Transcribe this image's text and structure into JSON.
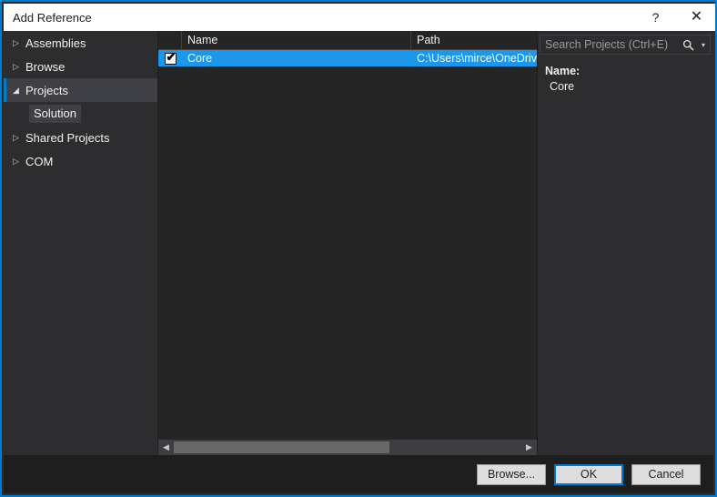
{
  "window": {
    "title": "Add Reference",
    "help_glyph": "?",
    "close_glyph": "✕",
    "accent_color": "#007acc",
    "selection_color": "#1c97ea",
    "titlebar_bg": "#ffffff",
    "panel_bg": "#2d2d30",
    "list_bg": "#252526"
  },
  "sidebar": {
    "items": [
      {
        "label": "Assemblies",
        "glyph": "▷",
        "expanded": false,
        "selected": false
      },
      {
        "label": "Browse",
        "glyph": "▷",
        "expanded": false,
        "selected": false
      },
      {
        "label": "Projects",
        "glyph": "◢",
        "expanded": true,
        "selected": true
      }
    ],
    "child": {
      "label": "Solution",
      "selected": true
    },
    "items_after": [
      {
        "label": "Shared Projects",
        "glyph": "▷",
        "expanded": false,
        "selected": false
      },
      {
        "label": "COM",
        "glyph": "▷",
        "expanded": false,
        "selected": false
      }
    ]
  },
  "list": {
    "columns": [
      {
        "key": "check",
        "label": ""
      },
      {
        "key": "name",
        "label": "Name"
      },
      {
        "key": "path",
        "label": "Path"
      }
    ],
    "rows": [
      {
        "checked": true,
        "check_glyph": "✔",
        "name": "Core",
        "path": "C:\\Users\\mirce\\OneDrive",
        "selected": true
      }
    ],
    "scrollbar": {
      "left_arrow": "◀",
      "right_arrow": "▶",
      "thumb_width_percent": 62
    }
  },
  "search": {
    "placeholder": "Search Projects (Ctrl+E)",
    "value": "",
    "icon": "search-icon",
    "dropdown_glyph": "▾"
  },
  "details": {
    "label": "Name:",
    "value": "Core"
  },
  "buttons": {
    "browse": "Browse...",
    "ok": "OK",
    "cancel": "Cancel"
  }
}
